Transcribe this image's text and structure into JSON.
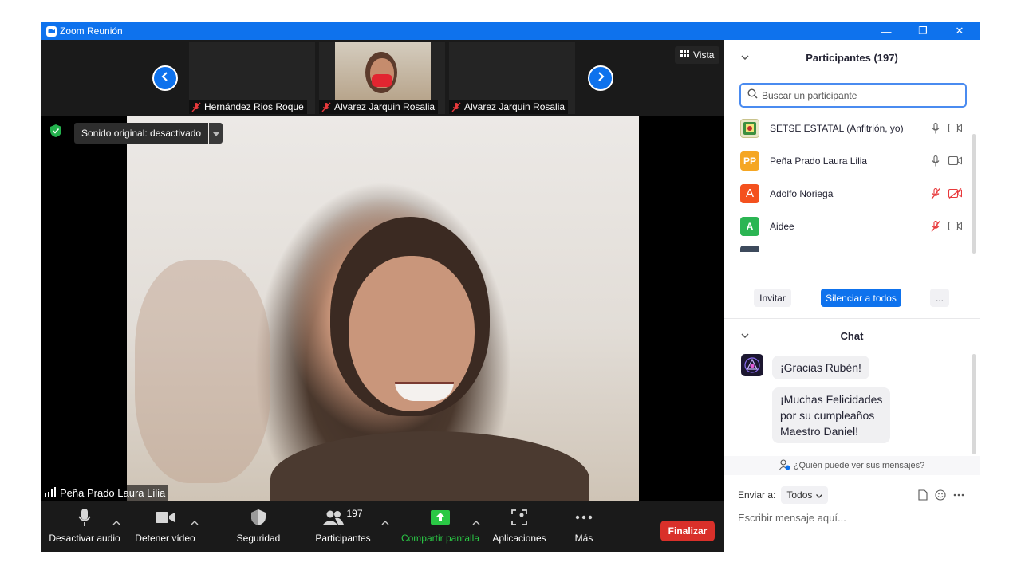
{
  "window": {
    "title": "Zoom Reunión",
    "controls": {
      "minimize": "—",
      "restore": "❐",
      "close": "✕"
    }
  },
  "gallery": {
    "view_label": "Vista",
    "thumbnails": [
      {
        "name": "Hernández Rios Roque",
        "muted": true
      },
      {
        "name": "Alvarez Jarquin Rosalia",
        "muted": true
      },
      {
        "name": "Alvarez Jarquin Rosalia",
        "muted": true
      }
    ]
  },
  "main_video": {
    "audio_tag": "Sonido original: desactivado",
    "speaker_name": "Peña Prado Laura Lilia"
  },
  "toolbar": {
    "items": [
      {
        "label": "Desactivar audio",
        "icon": "microphone-icon"
      },
      {
        "label": "Detener vídeo",
        "icon": "video-camera-icon"
      },
      {
        "label": "Seguridad",
        "icon": "shield-icon"
      },
      {
        "label": "Participantes",
        "icon": "participants-icon",
        "badge": "197"
      },
      {
        "label": "Compartir pantalla",
        "icon": "share-screen-icon"
      },
      {
        "label": "Aplicaciones",
        "icon": "apps-icon"
      },
      {
        "label": "Más",
        "icon": "more-dots-icon"
      }
    ],
    "end_label": "Finalizar"
  },
  "participants": {
    "title": "Participantes (197)",
    "search_placeholder": "Buscar un participante",
    "list": [
      {
        "name": "SETSE ESTATAL (Anfitrión, yo)",
        "avatar_text": "",
        "avatar_color": "#e9e6c7",
        "mic": "on",
        "cam": "on"
      },
      {
        "name": "Peña Prado Laura Lilia",
        "avatar_text": "PP",
        "avatar_color": "#f5a623",
        "mic": "on",
        "cam": "on"
      },
      {
        "name": "Adolfo Noriega",
        "avatar_text": "A",
        "avatar_color": "#f4511e",
        "mic": "off",
        "cam": "off"
      },
      {
        "name": "Aidee",
        "avatar_text": "A",
        "avatar_color": "#2bb553",
        "mic": "off",
        "cam": "on"
      }
    ],
    "invite_label": "Invitar",
    "mute_all_label": "Silenciar a todos",
    "more_label": "..."
  },
  "chat": {
    "title": "Chat",
    "messages": [
      "¡Gracias Rubén!",
      "¡Muchas Felicidades\npor su cumpleaños\nMaestro Daniel!"
    ],
    "visibility_label": "¿Quién puede ver sus mensajes?",
    "send_to_label": "Enviar a:",
    "send_to_value": "Todos",
    "input_placeholder": "Escribir mensaje aquí..."
  },
  "colors": {
    "accent": "#0e72ed",
    "end_button": "#d9302a",
    "share_button": "#2ac845",
    "muted_red": "#e8393b"
  }
}
